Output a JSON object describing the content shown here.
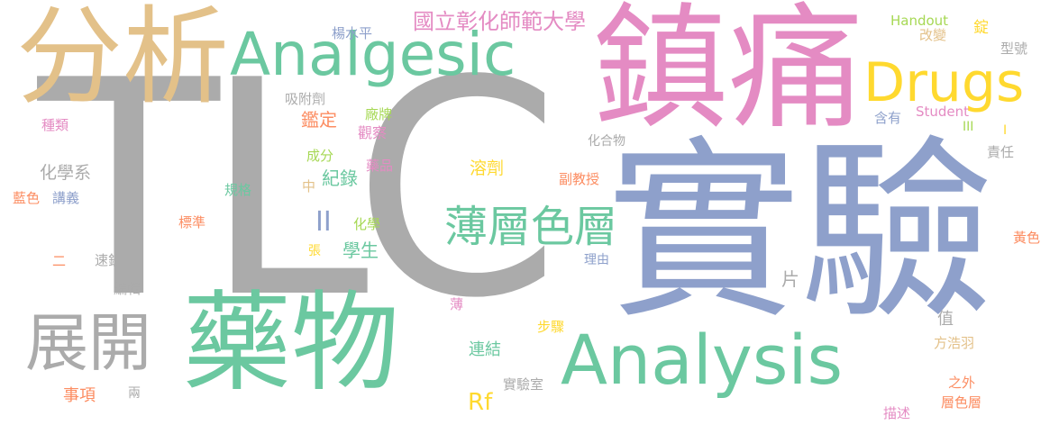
{
  "palette": {
    "gray": "#ababab",
    "tan": "#e3c189",
    "teal": "#6bc8a0",
    "pink": "#e48bc3",
    "blue": "#8ea0cb",
    "yellow": "#ffd92f",
    "orange": "#fc8d62",
    "lime": "#a6d854"
  },
  "words": [
    {
      "text": "TLC"
    },
    {
      "text": "實驗"
    },
    {
      "text": "鎮痛"
    },
    {
      "text": "分析"
    },
    {
      "text": "藥物"
    },
    {
      "text": "Analysis"
    },
    {
      "text": "Analgesic"
    },
    {
      "text": "展開"
    },
    {
      "text": "Drugs"
    },
    {
      "text": "薄層色層"
    },
    {
      "text": "國立彰化師範大學"
    },
    {
      "text": "楊水平"
    },
    {
      "text": "吸附劑"
    },
    {
      "text": "種類"
    },
    {
      "text": "鑑定"
    },
    {
      "text": "廠牌"
    },
    {
      "text": "觀察"
    },
    {
      "text": "化合物"
    },
    {
      "text": "化學系"
    },
    {
      "text": "成分"
    },
    {
      "text": "紀錄"
    },
    {
      "text": "藥品"
    },
    {
      "text": "溶劑"
    },
    {
      "text": "副教授"
    },
    {
      "text": "藍色"
    },
    {
      "text": "講義"
    },
    {
      "text": "規格"
    },
    {
      "text": "中"
    },
    {
      "text": "標準"
    },
    {
      "text": "II"
    },
    {
      "text": "化學"
    },
    {
      "text": "張"
    },
    {
      "text": "學生"
    },
    {
      "text": "二"
    },
    {
      "text": "速錠"
    },
    {
      "text": "編輯"
    },
    {
      "text": "理由"
    },
    {
      "text": "片"
    },
    {
      "text": "Handout"
    },
    {
      "text": "改變"
    },
    {
      "text": "錠"
    },
    {
      "text": "型號"
    },
    {
      "text": "Student"
    },
    {
      "text": "含有"
    },
    {
      "text": "I"
    },
    {
      "text": "III"
    },
    {
      "text": "責任"
    },
    {
      "text": "黃色"
    },
    {
      "text": "值"
    },
    {
      "text": "方浩羽"
    },
    {
      "text": "之外"
    },
    {
      "text": "層色層"
    },
    {
      "text": "描述"
    },
    {
      "text": "事項"
    },
    {
      "text": "兩"
    },
    {
      "text": "連結"
    },
    {
      "text": "Rf"
    },
    {
      "text": "實驗室"
    },
    {
      "text": "步驟"
    },
    {
      "text": "薄"
    }
  ]
}
